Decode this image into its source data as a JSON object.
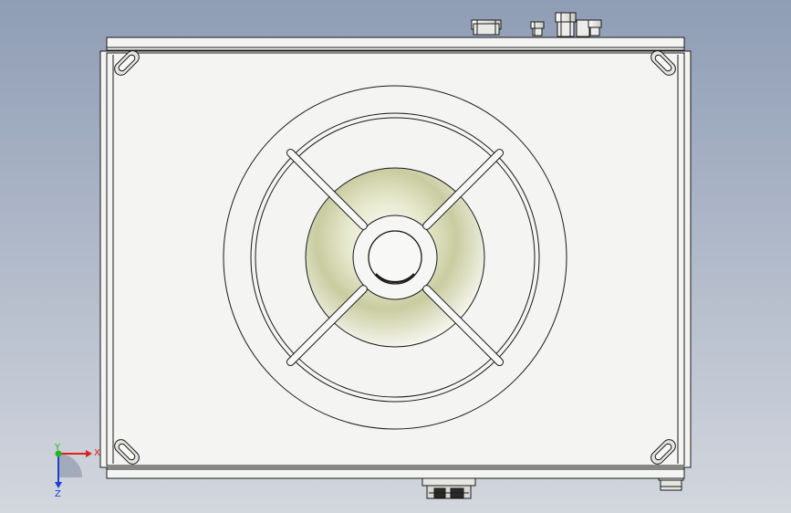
{
  "scene": {
    "type": "cad-viewport",
    "view": "front",
    "model": "enclosure-with-axial-fan",
    "colors": {
      "background_top": "#8f9db5",
      "background_bottom": "#d3d7de",
      "panel_fill": "#f4f4f2",
      "edge": "#1a1a1a",
      "hub_shade": "#d9dbb8",
      "axis_x": "#e0201b",
      "axis_y": "#22b822",
      "axis_z": "#1a3fd6"
    }
  },
  "triad": {
    "x_label": "X",
    "y_label": "Y",
    "z_label": "Z"
  }
}
